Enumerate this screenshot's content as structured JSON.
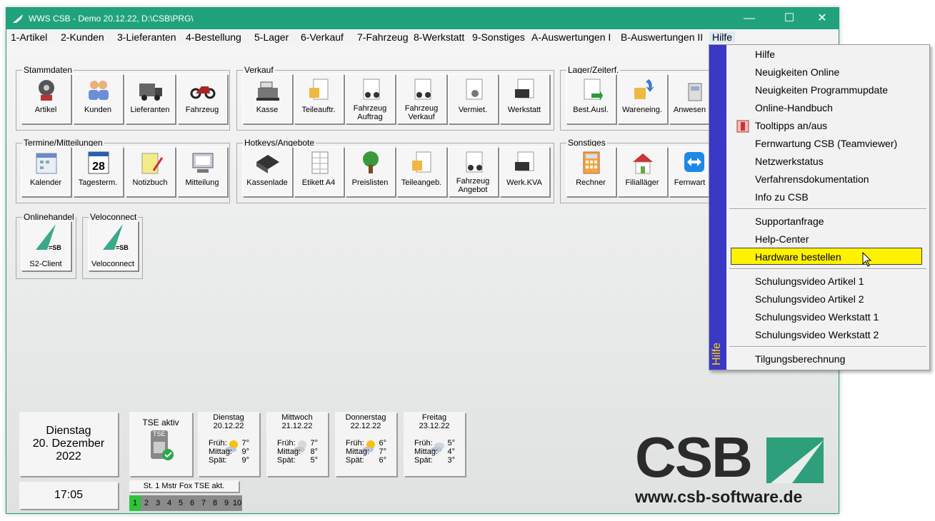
{
  "window": {
    "title": "WWS CSB - Demo  20.12.22, D:\\CSB\\PRG\\"
  },
  "menu": [
    {
      "label": "1-Artikel"
    },
    {
      "label": "2-Kunden"
    },
    {
      "label": "3-Lieferanten"
    },
    {
      "label": "4-Bestellung"
    },
    {
      "label": "5-Lager"
    },
    {
      "label": "6-Verkauf"
    },
    {
      "label": "7-Fahrzeug"
    },
    {
      "label": "8-Werkstatt"
    },
    {
      "label": "9-Sonstiges"
    },
    {
      "label": "A-Auswertungen I"
    },
    {
      "label": "B-Auswertungen II"
    },
    {
      "label": "Hilfe"
    }
  ],
  "groups": {
    "stammdaten": {
      "title": "Stammdaten",
      "tiles": [
        "Artikel",
        "Kunden",
        "Lieferanten",
        "Fahrzeug"
      ]
    },
    "verkauf": {
      "title": "Verkauf",
      "tiles": [
        "Kasse",
        "Teileauftr.",
        "Fahrzeug Auftrag",
        "Fahrzeug Verkauf",
        "Vermiet.",
        "Werkstatt"
      ]
    },
    "lager": {
      "title": "Lager/Zeiterf.",
      "tiles": [
        "Best.Ausl.",
        "Wareneing.",
        "Anwesen"
      ]
    },
    "termine": {
      "title": "Termine/Mitteilungen",
      "tiles": [
        "Kalender",
        "Tagesterm.",
        "Notizbuch",
        "Mitteilung"
      ]
    },
    "hotkeys": {
      "title": "Hotkeys/Angebote",
      "tiles": [
        "Kassenlade",
        "Etikett A4",
        "Preislisten",
        "Teileangeb.",
        "Fahrzeug Angebot",
        "Werk.KVA"
      ]
    },
    "sonstiges": {
      "title": "Sonstiges",
      "tiles": [
        "Rechner",
        "Filialläger",
        "Fernwart"
      ]
    },
    "onlinehandel": {
      "title": "Onlinehandel",
      "tiles": [
        "S2-Client"
      ]
    },
    "veloconnect": {
      "title": "Veloconnect",
      "tiles": [
        "Veloconnect"
      ]
    }
  },
  "date_panel": {
    "weekday": "Dienstag",
    "date": "20. Dezember",
    "year": "2022",
    "time": "17:05"
  },
  "tse": {
    "label": "TSE aktiv",
    "icon_text": "TSE",
    "status": "St. 1 Mstr Fox TSE akt."
  },
  "weather": [
    {
      "day": "Dienstag",
      "date": "20.12.22",
      "frueh": "7°",
      "mittag": "9°",
      "spaet": "9°"
    },
    {
      "day": "Mittwoch",
      "date": "21.12.22",
      "frueh": "7°",
      "mittag": "8°",
      "spaet": "5°"
    },
    {
      "day": "Donnerstag",
      "date": "22.12.22",
      "frueh": "6°",
      "mittag": "7°",
      "spaet": "6°"
    },
    {
      "day": "Freitag",
      "date": "23.12.22",
      "frueh": "5°",
      "mittag": "4°",
      "spaet": "3°"
    }
  ],
  "weather_labels": {
    "frueh": "Früh:",
    "mittag": "Mittag:",
    "spaet": "Spät:"
  },
  "keys": [
    "1",
    "2",
    "3",
    "4",
    "5",
    "6",
    "7",
    "8",
    "9",
    "10"
  ],
  "logo": {
    "text": "CSB",
    "url": "www.csb-software.de",
    "brand_color": "#2d9f7a"
  },
  "help_menu": {
    "strip_label": "Hilfe",
    "items": [
      "Hilfe",
      "Neuigkeiten Online",
      "Neuigkeiten Programmupdate",
      "Online-Handbuch",
      "Tooltipps an/aus",
      "Fernwartung CSB (Teamviewer)",
      "Netzwerkstatus",
      "Verfahrensdokumentation",
      "Info zu CSB",
      "Supportanfrage",
      "Help-Center",
      "Hardware bestellen",
      "Schulungsvideo Artikel 1",
      "Schulungsvideo Artikel 2",
      "Schulungsvideo Werkstatt 1",
      "Schulungsvideo Werkstatt 2",
      "Tilgungsberechnung"
    ],
    "highlighted": "Hardware bestellen",
    "highlight_color": "#fff200",
    "strip_color": "#3a39c6"
  }
}
